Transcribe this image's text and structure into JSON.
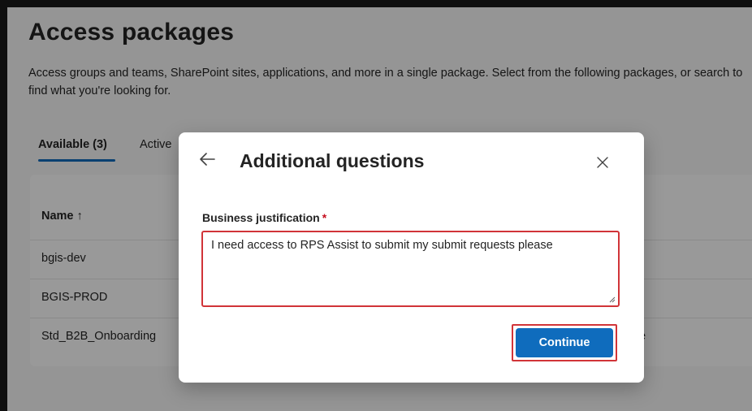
{
  "page": {
    "title": "Access packages",
    "description": "Access groups and teams, SharePoint sites, applications, and more in a single package. Select from the following packages, or search to find what you're looking for."
  },
  "tabs": [
    {
      "label": "Available (3)",
      "active": true
    },
    {
      "label": "Active",
      "active": false
    }
  ],
  "table": {
    "name_header": "Name ↑",
    "rows": [
      {
        "name": "bgis-dev",
        "extra": ""
      },
      {
        "name": "BGIS-PROD",
        "extra": ""
      },
      {
        "name": "Std_B2B_Onboarding",
        "extra": "e"
      }
    ]
  },
  "dialog": {
    "title": "Additional questions",
    "back_icon": "arrow-left-icon",
    "close_icon": "close-icon",
    "field_label": "Business justification",
    "required_marker": "*",
    "field_value": "I need access to RPS Assist to submit my submit requests please",
    "continue_label": "Continue"
  },
  "colors": {
    "accent": "#0f6cbd",
    "error_outline": "#d13438",
    "required": "#c50f1f"
  }
}
